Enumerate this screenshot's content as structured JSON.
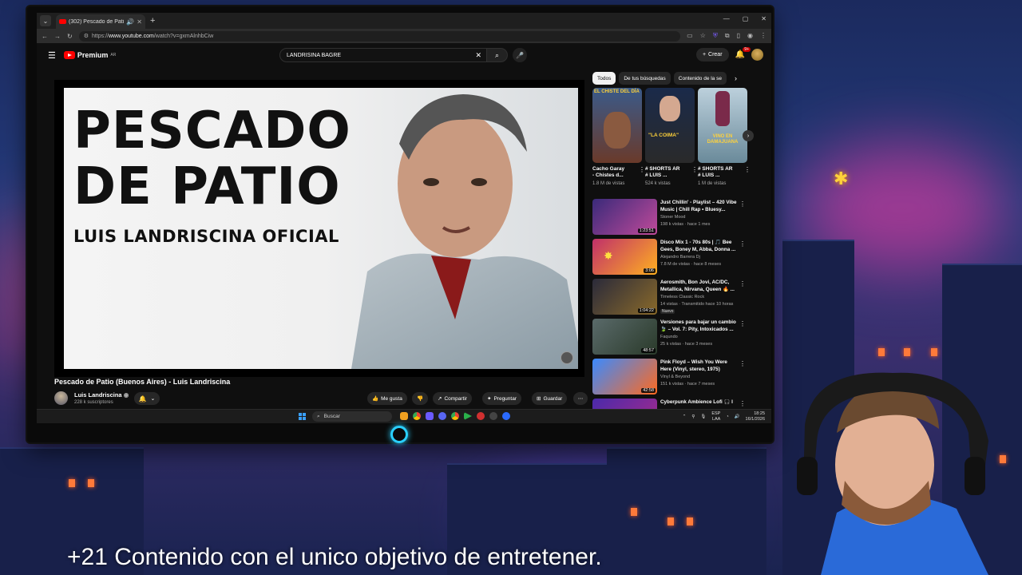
{
  "browser": {
    "tab_title": "(302) Pescado de Patio (Bu...",
    "url_prefix": "https://",
    "url_domain": "www.youtube.com",
    "url_path": "/watch?v=gxmAlnhbCiw"
  },
  "youtube": {
    "logo_text": "Premium",
    "logo_country": "AR",
    "search_value": "LANDRISINA BAGRE",
    "create_label": "Crear",
    "notification_count": "9+"
  },
  "video": {
    "thumb_line1": "PESCADO",
    "thumb_line2": "DE PATIO",
    "thumb_subtitle": "LUIS LANDRISCINA OFICIAL",
    "title": "Pescado de Patio (Buenos Aires) - Luis Landriscina",
    "channel_name": "Luis Landriscina",
    "channel_subs": "228 k suscriptores",
    "actions": {
      "like": "Me gusta",
      "share": "Compartir",
      "ask": "Preguntar",
      "save": "Guardar"
    }
  },
  "chips": [
    "Todos",
    "De tus búsquedas",
    "Contenido de la se"
  ],
  "shorts": [
    {
      "title_l1": "Cacho Garay",
      "title_l2": "- Chistes d...",
      "views": "1.8 M de vistas",
      "banner": "EL CHISTE DEL DÍA"
    },
    {
      "title_l1": "# SHORTS AR",
      "title_l2": "# LUIS ...",
      "views": "524 k vistas",
      "banner": "\"LA COIMA\""
    },
    {
      "title_l1": "# SHORTS AR",
      "title_l2": "# LUIS ...",
      "views": "1 M de vistas",
      "banner": "VINO EN DAMAJUANA"
    }
  ],
  "recommendations": [
    {
      "title": "Just Chillin' - Playlist – 420 Vibe Music | Chill Rap • Bluesy...",
      "channel": "Stoner Mood",
      "meta": "198 k vistas · hace 1 mes",
      "duration": "1:23:51",
      "badge": ""
    },
    {
      "title": "Disco Mix 1 - 70s 80s | 🎵 Bee Gees, Boney M, Abba, Donna ...",
      "channel": "Alejandro Barrera Dj",
      "meta": "7.8 M de vistas · hace 8 meses",
      "duration": "3:06",
      "badge": ""
    },
    {
      "title": "Aerosmith, Bon Jovi, AC/DC, Metallica, Nirvana, Queen 🔥 ...",
      "channel": "Timeless Classic Rock",
      "meta": "14 vistas · Transmitido hace 10 horas",
      "duration": "1:04:22",
      "badge": "Nuevo"
    },
    {
      "title": "Versiones para bajar un cambio 🍃 – Vol. 7: Pity, Intoxicados ...",
      "channel": "Faqundo",
      "meta": "25 k vistas · hace 3 meses",
      "duration": "48:57",
      "badge": ""
    },
    {
      "title": "Pink Floyd – Wish You Were Here (Vinyl, stereo, 1975)",
      "channel": "Vinyl & Beyond",
      "meta": "151 k vistas · hace 7 meses",
      "duration": "42:58",
      "badge": ""
    },
    {
      "title": "Cyberpunk Ambience Lofi 🎧 I",
      "channel": "",
      "meta": "",
      "duration": "",
      "badge": ""
    }
  ],
  "taskbar": {
    "search_placeholder": "Buscar",
    "lang_l1": "ESP",
    "lang_l2": "LAA",
    "time": "18:25",
    "date": "16/1/2026"
  },
  "overlay_caption": "+21 Contenido con el unico objetivo de entretener.",
  "colors": {
    "yt_red": "#ff0000",
    "yt_bg": "#0f0f0f",
    "accent_neon": "#2ad0ff"
  }
}
